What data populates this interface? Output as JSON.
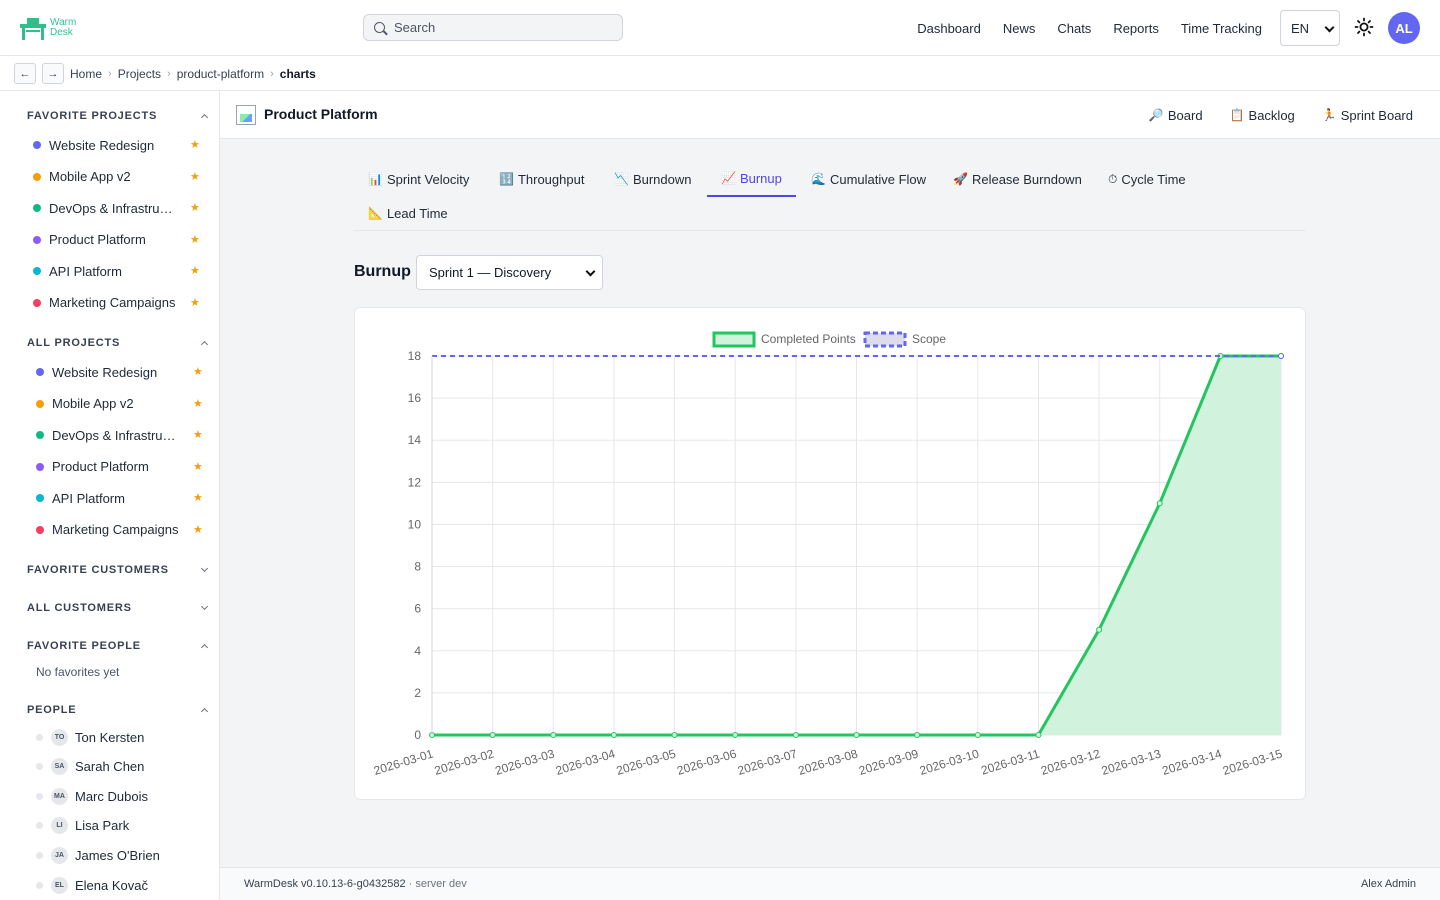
{
  "app": {
    "logo_lines": [
      "Warm",
      "Desk"
    ],
    "search_placeholder": "Search",
    "nav": [
      "Dashboard",
      "News",
      "Chats",
      "Reports",
      "Time Tracking"
    ],
    "language": "EN",
    "user_initials": "AL"
  },
  "breadcrumb": {
    "back": "←",
    "forward": "→",
    "items": [
      "Home",
      "Projects",
      "product-platform",
      "charts"
    ],
    "separator": "›"
  },
  "sidebar": {
    "favorite_projects_title": "FAVORITE PROJECTS",
    "favorite_projects": [
      {
        "name": "Website Redesign",
        "color": "#6366f1"
      },
      {
        "name": "Mobile App v2",
        "color": "#f59e0b"
      },
      {
        "name": "DevOps & Infrastructure",
        "color": "#10b981"
      },
      {
        "name": "Product Platform",
        "color": "#8b5cf6"
      },
      {
        "name": "API Platform",
        "color": "#06b6d4"
      },
      {
        "name": "Marketing Campaigns",
        "color": "#f43f5e"
      }
    ],
    "all_projects_title": "ALL PROJECTS",
    "all_projects": [
      {
        "name": "Website Redesign",
        "color": "#6366f1"
      },
      {
        "name": "Mobile App v2",
        "color": "#f59e0b"
      },
      {
        "name": "DevOps & Infrastructure",
        "color": "#10b981"
      },
      {
        "name": "Product Platform",
        "color": "#8b5cf6"
      },
      {
        "name": "API Platform",
        "color": "#06b6d4"
      },
      {
        "name": "Marketing Campaigns",
        "color": "#f43f5e"
      }
    ],
    "star": "★",
    "favorite_customers_title": "FAVORITE CUSTOMERS",
    "all_customers_title": "ALL CUSTOMERS",
    "favorite_people_title": "FAVORITE PEOPLE",
    "favorite_people_empty": "No favorites yet",
    "people_title": "PEOPLE",
    "people": [
      {
        "initials": "TO",
        "name": "Ton Kersten"
      },
      {
        "initials": "SA",
        "name": "Sarah Chen"
      },
      {
        "initials": "MA",
        "name": "Marc Dubois"
      },
      {
        "initials": "LI",
        "name": "Lisa Park"
      },
      {
        "initials": "JA",
        "name": "James O'Brien"
      },
      {
        "initials": "EL",
        "name": "Elena Kovač"
      }
    ]
  },
  "project": {
    "title": "Product Platform",
    "actions": [
      {
        "icon": "🔎",
        "label": "Board"
      },
      {
        "icon": "📋",
        "label": "Backlog"
      },
      {
        "icon": "🏃",
        "label": "Sprint Board"
      }
    ]
  },
  "tabs": [
    {
      "icon": "📊",
      "label": "Sprint Velocity"
    },
    {
      "icon": "🔢",
      "label": "Throughput"
    },
    {
      "icon": "📉",
      "label": "Burndown"
    },
    {
      "icon": "📈",
      "label": "Burnup",
      "active": true
    },
    {
      "icon": "🌊",
      "label": "Cumulative Flow"
    },
    {
      "icon": "🚀",
      "label": "Release Burndown"
    },
    {
      "icon": "⏱",
      "label": "Cycle Time"
    },
    {
      "icon": "📐",
      "label": "Lead Time"
    }
  ],
  "chart_header": {
    "label": "Burnup",
    "sprint_selected": "Sprint 1 — Discovery"
  },
  "chart_data": {
    "type": "line",
    "x": [
      "2026-03-01",
      "2026-03-02",
      "2026-03-03",
      "2026-03-04",
      "2026-03-05",
      "2026-03-06",
      "2026-03-07",
      "2026-03-08",
      "2026-03-09",
      "2026-03-10",
      "2026-03-11",
      "2026-03-12",
      "2026-03-13",
      "2026-03-14",
      "2026-03-15"
    ],
    "series": [
      {
        "name": "Completed Points",
        "values": [
          0,
          0,
          0,
          0,
          0,
          0,
          0,
          0,
          0,
          0,
          0,
          5,
          11,
          18,
          18
        ],
        "color": "#22c55e",
        "fill": "#d1f2dd",
        "style": "solid",
        "area": true
      },
      {
        "name": "Scope",
        "values": [
          18,
          18,
          18,
          18,
          18,
          18,
          18,
          18,
          18,
          18,
          18,
          18,
          18,
          18,
          18
        ],
        "color": "#6366f1",
        "style": "dashed",
        "area": false
      }
    ],
    "yticks": [
      0,
      2,
      4,
      6,
      8,
      10,
      12,
      14,
      16,
      18
    ],
    "ylim": [
      0,
      18
    ],
    "grid": true,
    "legend_position": "top-center",
    "title": "",
    "xlabel": "",
    "ylabel": ""
  },
  "footer": {
    "version": "WarmDesk v0.10.13-6-g0432582",
    "server": " · server dev",
    "user": "Alex Admin"
  }
}
